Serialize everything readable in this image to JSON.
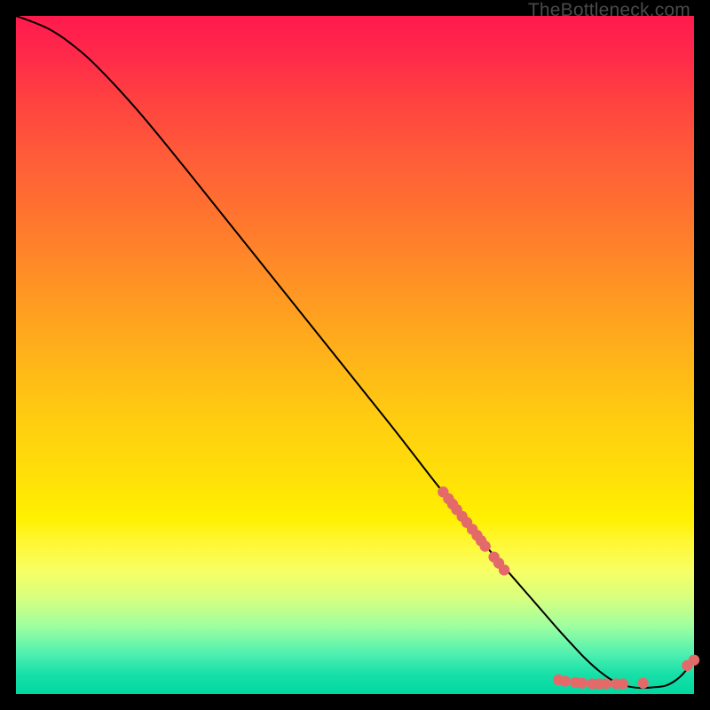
{
  "attribution": "TheBottleneck.com",
  "colors": {
    "line": "#000000",
    "marker_fill": "#e46a6a",
    "marker_stroke": "#9c3a3a"
  },
  "chart_data": {
    "type": "line",
    "title": "",
    "xlabel": "",
    "ylabel": "",
    "xlim": [
      0,
      100
    ],
    "ylim": [
      0,
      100
    ],
    "x": [
      0,
      2,
      5,
      8,
      12,
      18,
      25,
      35,
      45,
      55,
      62,
      66,
      68,
      70,
      72,
      74,
      76,
      78,
      80,
      82,
      84,
      86,
      88,
      90,
      92,
      94,
      96,
      98,
      100
    ],
    "values": [
      100,
      99.3,
      98.0,
      96.0,
      92.5,
      86.0,
      77.5,
      65.0,
      52.5,
      40.0,
      31.0,
      26.0,
      23.5,
      21.0,
      18.7,
      16.4,
      14.1,
      11.8,
      9.5,
      7.3,
      5.2,
      3.4,
      2.0,
      1.2,
      0.9,
      1.0,
      1.3,
      2.6,
      5.0
    ],
    "marker_clusters": [
      {
        "comment": "diagonal cluster on descending segment",
        "points": [
          {
            "x": 63.0,
            "y": 29.8
          },
          {
            "x": 63.8,
            "y": 28.8
          },
          {
            "x": 64.4,
            "y": 28.0
          },
          {
            "x": 65.0,
            "y": 27.2
          },
          {
            "x": 65.8,
            "y": 26.2
          },
          {
            "x": 66.5,
            "y": 25.3
          },
          {
            "x": 67.3,
            "y": 24.3
          },
          {
            "x": 68.0,
            "y": 23.4
          },
          {
            "x": 68.6,
            "y": 22.6
          },
          {
            "x": 69.2,
            "y": 21.8
          },
          {
            "x": 70.5,
            "y": 20.2
          },
          {
            "x": 71.2,
            "y": 19.3
          },
          {
            "x": 72.0,
            "y": 18.3
          }
        ]
      },
      {
        "comment": "bottom flat cluster near minimum",
        "points": [
          {
            "x": 80.0,
            "y": 2.1
          },
          {
            "x": 81.0,
            "y": 1.9
          },
          {
            "x": 82.5,
            "y": 1.7
          },
          {
            "x": 83.5,
            "y": 1.6
          },
          {
            "x": 85.0,
            "y": 1.5
          },
          {
            "x": 86.0,
            "y": 1.5
          },
          {
            "x": 87.0,
            "y": 1.5
          },
          {
            "x": 88.5,
            "y": 1.5
          },
          {
            "x": 89.5,
            "y": 1.5
          },
          {
            "x": 92.5,
            "y": 1.6
          }
        ]
      },
      {
        "comment": "uptick pair at far right",
        "points": [
          {
            "x": 99.0,
            "y": 4.2
          },
          {
            "x": 100.0,
            "y": 5.0
          }
        ]
      }
    ]
  }
}
